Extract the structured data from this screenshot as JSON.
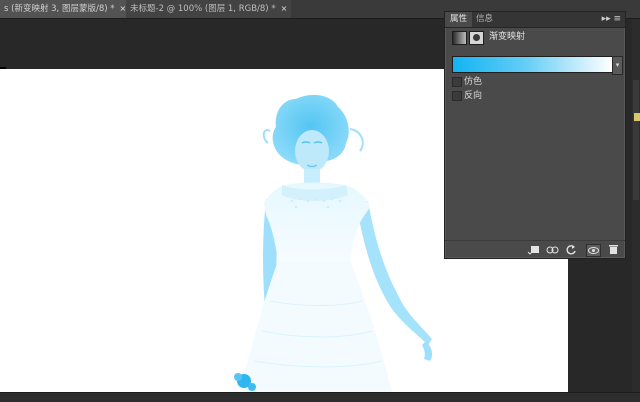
{
  "document_tabs": [
    {
      "label": "s (新变映射 3, 图层蒙版/8) *",
      "close": "×",
      "active": true
    },
    {
      "label": "未标题-2 @ 100% (图层 1, RGB/8) *",
      "close": "×",
      "active": false
    }
  ],
  "properties_panel": {
    "tabs": [
      "属性",
      "信息"
    ],
    "menu_glyph": "▸▸ ≡",
    "adjustment_title": "渐变映射",
    "gradient": {
      "start_color": "#12b4f2",
      "end_color": "#ffffff",
      "dropdown_glyph": "▾"
    },
    "options": [
      {
        "label": "仿色",
        "checked": false
      },
      {
        "label": "反向",
        "checked": false
      }
    ],
    "footer_icons": [
      "clip-to-layer-icon",
      "view-previous-state-icon",
      "reset-icon",
      "visibility-eye-icon",
      "trash-icon"
    ]
  },
  "colors": {
    "workspace": "#282828",
    "panel": "#4a4a4a",
    "tint": "#5fd2fb"
  }
}
